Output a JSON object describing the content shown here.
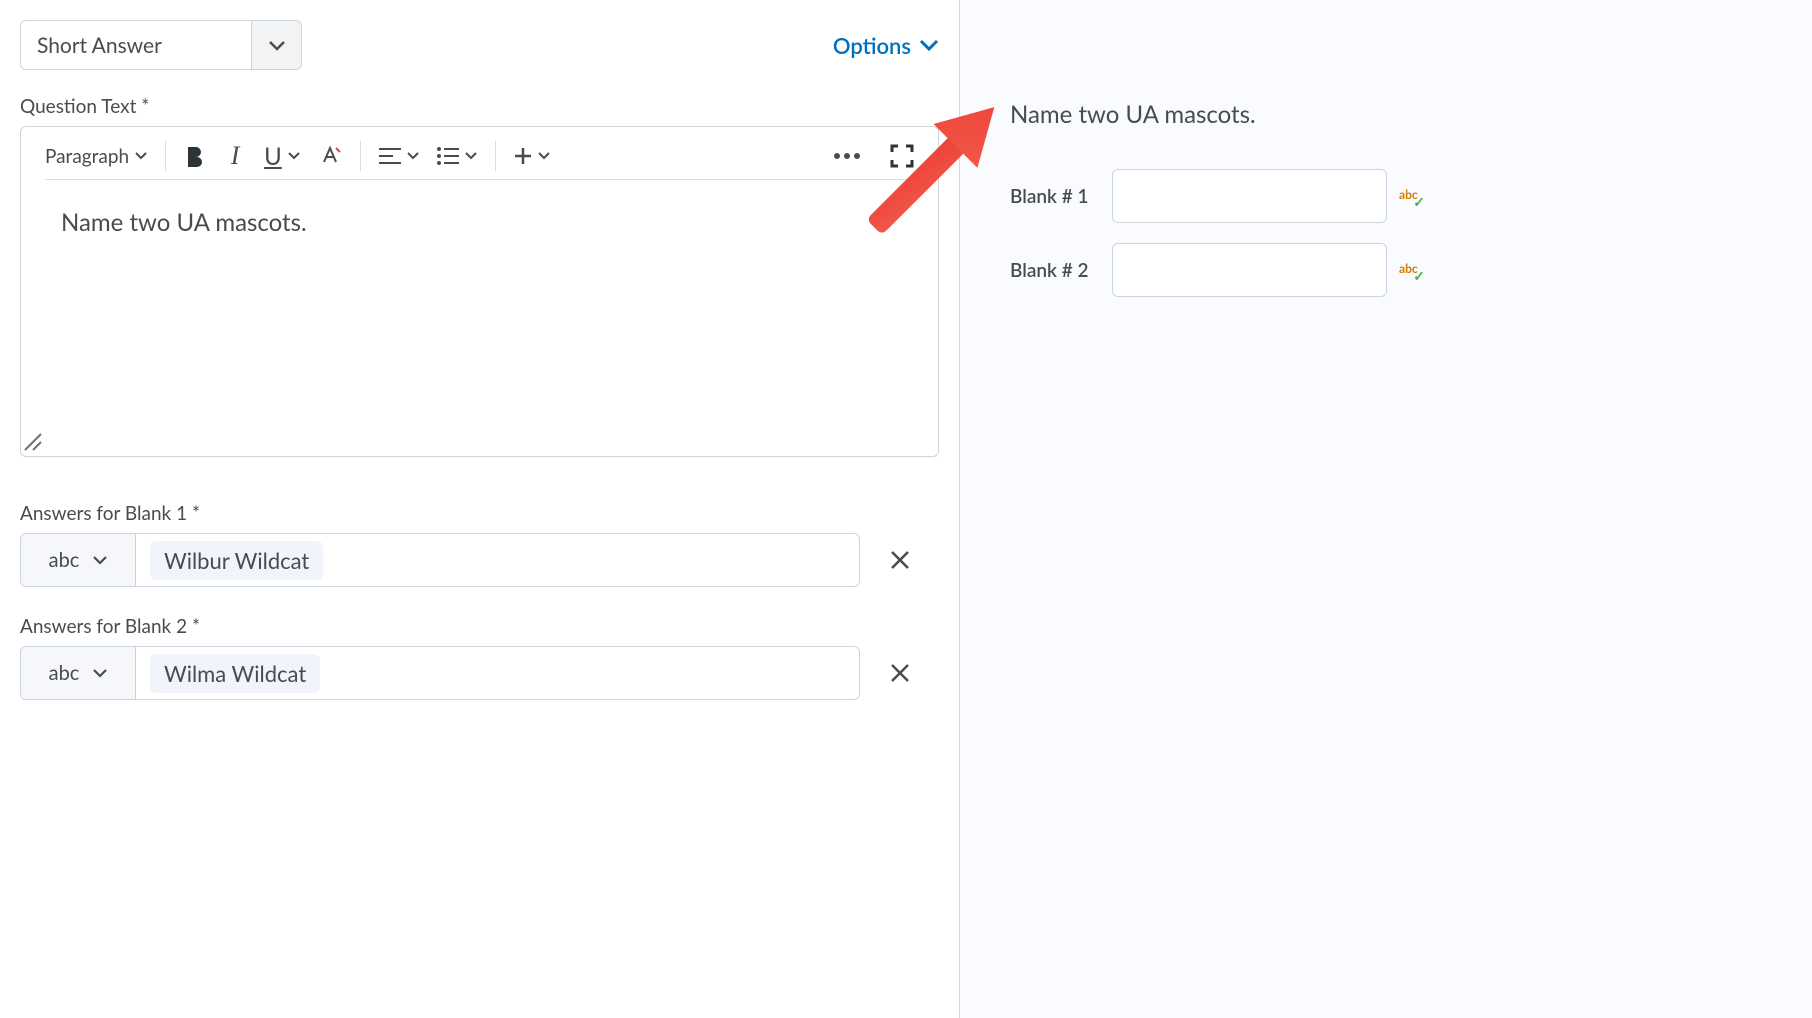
{
  "top": {
    "question_type": "Short Answer",
    "options_label": "Options"
  },
  "question_text_label": "Question Text *",
  "editor": {
    "block_format": "Paragraph",
    "content": "Name two UA mascots."
  },
  "answers": [
    {
      "label": "Answers for Blank 1 *",
      "mode": "abc",
      "value": "Wilbur Wildcat"
    },
    {
      "label": "Answers for Blank 2 *",
      "mode": "abc",
      "value": "Wilma Wildcat"
    }
  ],
  "preview": {
    "question": "Name two UA mascots.",
    "blanks": [
      {
        "label": "Blank # 1",
        "spellcheck_indicator": "abc"
      },
      {
        "label": "Blank # 2",
        "spellcheck_indicator": "abc"
      }
    ]
  }
}
